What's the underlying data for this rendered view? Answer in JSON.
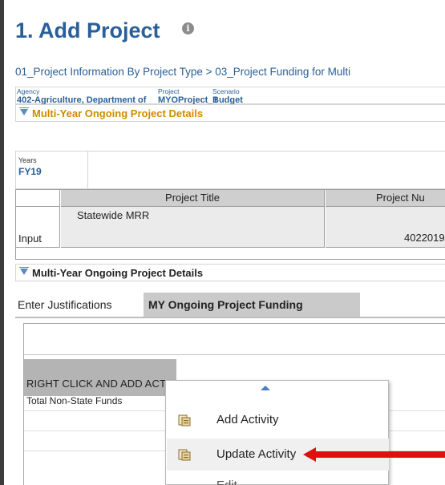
{
  "page": {
    "title": "1. Add Project",
    "breadcrumb": "01_Project Information By Project Type > 03_Project Funding for Multi"
  },
  "context": {
    "agency_label": "Agency",
    "agency_value": "402-Agriculture, Department of",
    "project_label": "Project",
    "project_value": "MYOProject_1",
    "scenario_label": "Scenario",
    "scenario_value": "Budget"
  },
  "section1": {
    "label": "Multi-Year Ongoing Project Details"
  },
  "years": {
    "label": "Years",
    "value": "FY19"
  },
  "grid": {
    "headers": [
      "Project Title",
      "Project Nu"
    ],
    "row_header": "Input",
    "cells": [
      "Statewide MRR",
      "4022019"
    ]
  },
  "section2": {
    "label": "Multi-Year Ongoing Project Details"
  },
  "tabs": [
    {
      "label": "Enter Justifications"
    },
    {
      "label": "MY Ongoing Project Funding"
    }
  ],
  "content": {
    "instruction": "RIGHT CLICK AND ADD ACTIVITY FOR PROJECT COSTS",
    "total_row": "Total Non-State Funds"
  },
  "context_menu": {
    "items": [
      {
        "label": "Add Activity",
        "icon": "activity-icon"
      },
      {
        "label": "Update Activity",
        "icon": "activity-icon"
      },
      {
        "label": "Edit",
        "icon": ""
      }
    ]
  },
  "colors": {
    "accent": "#2a5f97",
    "section_highlight": "#d08a00",
    "annotation_arrow": "#e01010"
  }
}
